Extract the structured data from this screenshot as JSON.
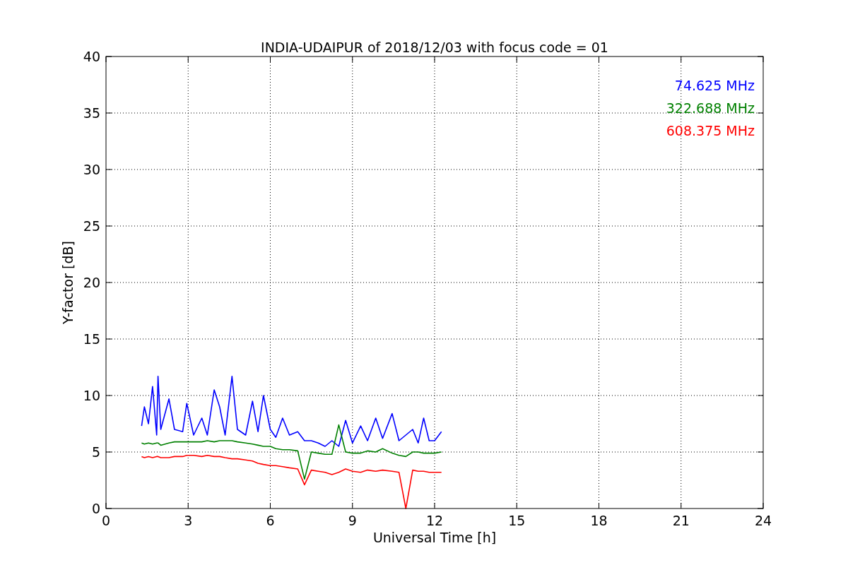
{
  "figure": {
    "chart_data": {
      "type": "line",
      "title": "INDIA-UDAIPUR of 2018/12/03 with focus code = 01",
      "xlabel": "Universal Time [h]",
      "ylabel": "Y-factor [dB]",
      "x": [
        1.3,
        1.4,
        1.55,
        1.7,
        1.85,
        1.9,
        2.0,
        2.3,
        2.5,
        2.8,
        2.95,
        3.2,
        3.5,
        3.7,
        3.95,
        4.15,
        4.35,
        4.6,
        4.8,
        5.1,
        5.35,
        5.55,
        5.75,
        6.0,
        6.2,
        6.45,
        6.7,
        7.0,
        7.25,
        7.5,
        7.75,
        8.0,
        8.25,
        8.5,
        8.75,
        9.0,
        9.3,
        9.55,
        9.85,
        10.1,
        10.45,
        10.7,
        10.95,
        11.2,
        11.4,
        11.6,
        11.8,
        12.0,
        12.25
      ],
      "series": [
        {
          "name": "74.625 MHz",
          "color": "#0000ff",
          "values": [
            7.3,
            9.0,
            7.5,
            10.8,
            6.5,
            11.7,
            7.0,
            9.7,
            7.0,
            6.8,
            9.3,
            6.5,
            8.0,
            6.5,
            10.5,
            9.0,
            6.5,
            11.7,
            7.0,
            6.5,
            9.5,
            6.8,
            10.0,
            7.0,
            6.3,
            8.0,
            6.5,
            6.8,
            6.0,
            6.0,
            5.8,
            5.5,
            6.0,
            5.5,
            7.8,
            5.8,
            7.3,
            6.0,
            8.0,
            6.2,
            8.4,
            6.0,
            6.5,
            7.0,
            5.8,
            8.0,
            6.0,
            6.0,
            6.8
          ]
        },
        {
          "name": "322.688 MHz",
          "color": "#008000",
          "values": [
            5.8,
            5.7,
            5.8,
            5.7,
            5.8,
            5.8,
            5.6,
            5.8,
            5.9,
            5.9,
            5.9,
            5.9,
            5.9,
            6.0,
            5.9,
            6.0,
            6.0,
            6.0,
            5.9,
            5.8,
            5.7,
            5.6,
            5.5,
            5.5,
            5.3,
            5.2,
            5.2,
            5.1,
            2.6,
            5.0,
            4.9,
            4.8,
            4.8,
            7.4,
            5.0,
            4.9,
            4.9,
            5.1,
            5.0,
            5.3,
            4.9,
            4.7,
            4.6,
            5.0,
            5.0,
            4.9,
            4.9,
            4.9,
            5.0
          ]
        },
        {
          "name": "608.375 MHz",
          "color": "#ff0000",
          "values": [
            4.6,
            4.5,
            4.6,
            4.5,
            4.6,
            4.6,
            4.5,
            4.5,
            4.6,
            4.6,
            4.7,
            4.7,
            4.6,
            4.7,
            4.6,
            4.6,
            4.5,
            4.4,
            4.4,
            4.3,
            4.2,
            4.0,
            3.9,
            3.8,
            3.8,
            3.7,
            3.6,
            3.5,
            2.1,
            3.4,
            3.3,
            3.2,
            3.0,
            3.2,
            3.5,
            3.3,
            3.2,
            3.4,
            3.3,
            3.4,
            3.3,
            3.2,
            0.0,
            3.4,
            3.3,
            3.3,
            3.2,
            3.2,
            3.2
          ]
        }
      ],
      "grid": true,
      "xlim": [
        0,
        24
      ],
      "ylim": [
        0,
        40
      ],
      "xticks": [
        0,
        3,
        6,
        9,
        12,
        15,
        18,
        21,
        24
      ],
      "yticks": [
        0,
        5,
        10,
        15,
        20,
        25,
        30,
        35,
        40
      ]
    }
  }
}
